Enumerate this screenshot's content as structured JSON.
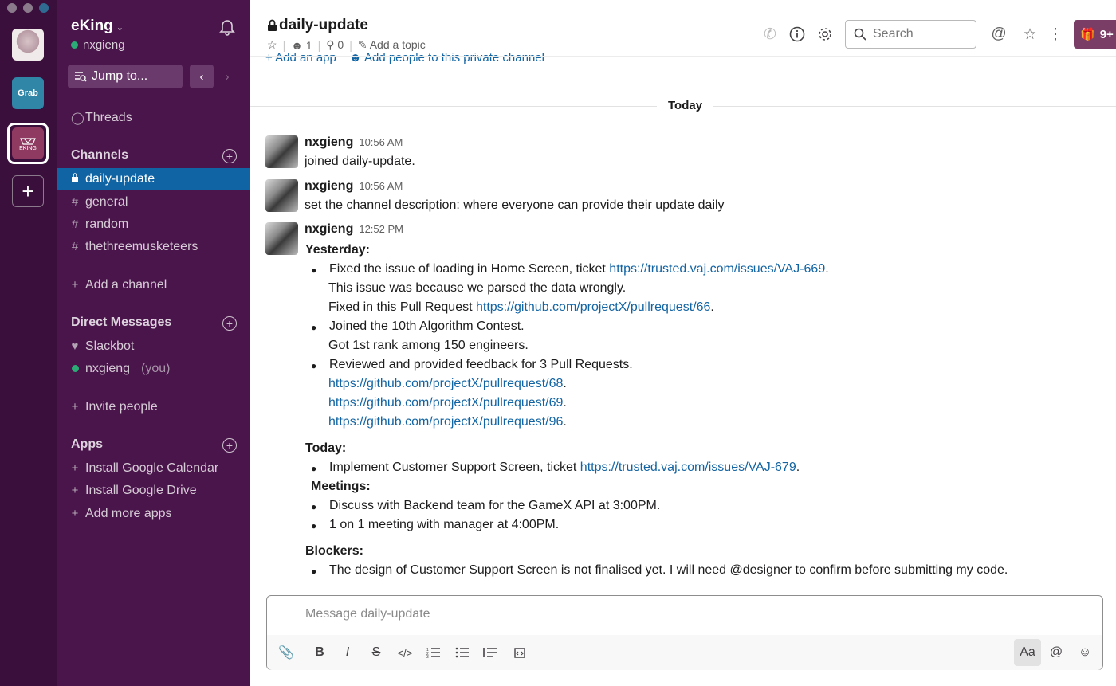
{
  "rail": {
    "workspaces": [
      {
        "name": "avatar-workspace",
        "label": ""
      },
      {
        "name": "grab",
        "label": "Grab"
      },
      {
        "name": "eking",
        "label": "EKING"
      }
    ],
    "add_label": "+"
  },
  "sidebar": {
    "team_name": "eKing",
    "user": "nxgieng",
    "jump_label": "Jump to...",
    "threads_label": "Threads",
    "channels_header": "Channels",
    "channels": [
      {
        "prefix": "lock",
        "label": "daily-update",
        "active": true
      },
      {
        "prefix": "#",
        "label": "general"
      },
      {
        "prefix": "#",
        "label": "random"
      },
      {
        "prefix": "#",
        "label": "thethreemusketeers"
      }
    ],
    "add_channel_label": "Add a channel",
    "dm_header": "Direct Messages",
    "dms": [
      {
        "label": "Slackbot",
        "suffix": ""
      },
      {
        "label": "nxgieng",
        "suffix": "(you)"
      }
    ],
    "invite_label": "Invite people",
    "apps_header": "Apps",
    "apps": [
      {
        "label": "Install Google Calendar"
      },
      {
        "label": "Install Google Drive"
      },
      {
        "label": "Add more apps"
      }
    ]
  },
  "header": {
    "channel_name": "daily-update",
    "members_count": "1",
    "pins_count": "0",
    "add_topic_label": "Add a topic",
    "search_placeholder": "Search",
    "gift_label": "9+",
    "add_app_label": "Add an app",
    "add_people_label": "Add people to this private channel"
  },
  "messages": {
    "divider_label": "Today",
    "m1": {
      "user": "nxgieng",
      "time": "10:56 AM",
      "text": "joined daily-update."
    },
    "m2": {
      "user": "nxgieng",
      "time": "10:56 AM",
      "text": "set the channel description: where everyone can provide their update daily"
    },
    "m3": {
      "user": "nxgieng",
      "time": "12:52 PM",
      "yesterday_label": "Yesterday:",
      "y1_text": "Fixed the issue of loading in Home Screen, ticket ",
      "y1_link": "https://trusted.vaj.com/issues/VAJ-669",
      "y1_line2": "This issue was because we parsed the data wrongly.",
      "y1_line3_text": "Fixed in this Pull Request ",
      "y1_line3_link": "https://github.com/projectX/pullrequest/66",
      "y2_text": "Joined the 10th Algorithm Contest.",
      "y2_line2": "Got 1st rank among 150 engineers.",
      "y3_text": "Reviewed and provided feedback for 3 Pull Requests.",
      "y3_links": [
        "https://github.com/projectX/pullrequest/68",
        "https://github.com/projectX/pullrequest/69",
        "https://github.com/projectX/pullrequest/96"
      ],
      "today_label": "Today:",
      "t1_text": "Implement Customer Support Screen, ticket ",
      "t1_link": "https://trusted.vaj.com/issues/VAJ-679",
      "meetings_label": "Meetings:",
      "meet1": "Discuss with Backend team for the GameX API at 3:00PM.",
      "meet2": "1 on 1 meeting with manager at 4:00PM.",
      "blockers_label": "Blockers:",
      "block1": "The design of Customer Support Screen is not finalised yet. I will need @designer to confirm before submitting my code."
    }
  },
  "composer": {
    "placeholder": "Message daily-update",
    "aa_label": "Aa"
  },
  "colors": {
    "rail": "#3b0f3c",
    "sidebar": "#4a154b",
    "active_channel": "#1164a3",
    "link": "#1264a3",
    "presence": "#2bac76"
  }
}
